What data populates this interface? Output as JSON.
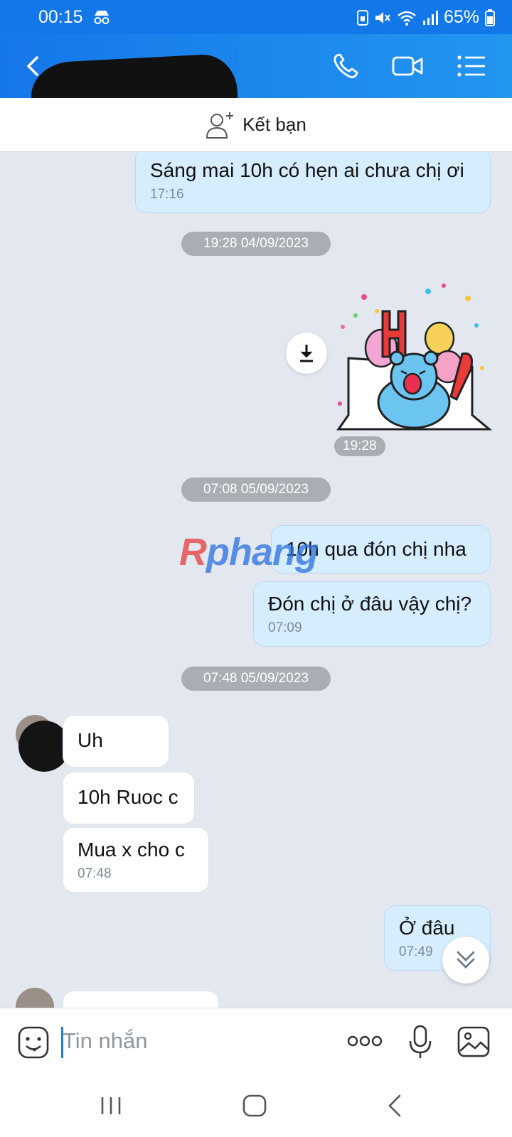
{
  "status_bar": {
    "time": "00:15",
    "battery": "65%",
    "icons": [
      "incognito-icon",
      "sim-icon",
      "mute-icon",
      "wifi-icon",
      "signal-icon",
      "battery-icon"
    ]
  },
  "header": {
    "icons": [
      "back-arrow-icon",
      "phone-icon",
      "video-call-icon",
      "menu-list-icon"
    ]
  },
  "friend_bar": {
    "label": "Kết bạn",
    "icon": "add-friend-icon"
  },
  "messages": [
    {
      "from": "me",
      "text": "Sáng mai 10h có hẹn ai chưa chị ơi",
      "time": "17:16"
    },
    {
      "date_divider": "19:28 04/09/2023"
    },
    {
      "from": "me",
      "sticker": "sticker-hi-bear",
      "time": "19:28"
    },
    {
      "date_divider": "07:08 05/09/2023"
    },
    {
      "from": "me",
      "text": "10h qua đón chị nha"
    },
    {
      "from": "me",
      "text": "Đón chị ở đâu vậy chị?",
      "time": "07:09"
    },
    {
      "date_divider": "07:48 05/09/2023"
    },
    {
      "from": "them",
      "text": "Uh"
    },
    {
      "from": "them",
      "text": "10h Ruoc c"
    },
    {
      "from": "them",
      "text": "Mua x cho c",
      "time": "07:48"
    },
    {
      "from": "me",
      "text": "Ở đâu",
      "time": "07:49"
    }
  ],
  "watermark": {
    "first": "R",
    "rest": "phang"
  },
  "input": {
    "placeholder": "Tin nhắn",
    "icons": [
      "emoji-icon",
      "more-dots-icon",
      "microphone-icon",
      "image-icon"
    ]
  },
  "nav": {
    "icons": [
      "recent-apps-icon",
      "home-icon",
      "back-icon"
    ]
  },
  "colors": {
    "header": "#1577ea",
    "my_bubble": "#d6edfd",
    "their_bubble": "#ffffff",
    "chat_bg": "#e3e8f0"
  }
}
